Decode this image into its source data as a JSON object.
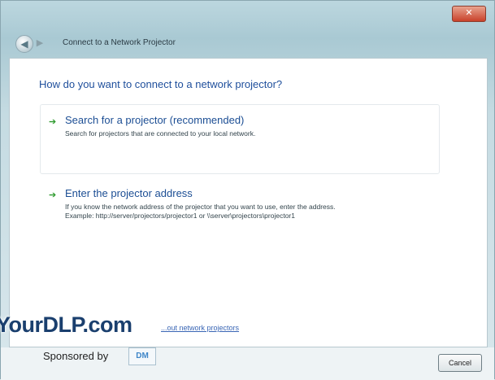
{
  "window": {
    "close_label": "✕"
  },
  "nav": {
    "back_icon": "◀",
    "forward_icon": "▶",
    "breadcrumb": "Connect to a Network Projector"
  },
  "main": {
    "question": "How do you want to connect to a network projector?",
    "options": [
      {
        "title": "Search for a projector (recommended)",
        "desc_lines": [
          "Search for projectors that are connected to your local network."
        ],
        "icon": "green-arrow-icon"
      },
      {
        "title": "Enter the projector address",
        "desc_lines": [
          "If you know the network address of the projector that you want to use, enter the address.",
          "Example: http://server/projectors/projector1 or \\\\server\\projectors\\projector1"
        ],
        "icon": "green-arrow-icon"
      }
    ],
    "link_text": "...out network projectors"
  },
  "footer": {
    "cancel_label": "Cancel"
  },
  "overlay": {
    "watermark": "YourDLP.com",
    "sponsored_by": "Sponsored by",
    "sponsor_logo": "DM"
  },
  "colors": {
    "accent_text": "#1c4e94",
    "arrow_green": "#2e9a2e",
    "close_red": "#c9412a"
  }
}
